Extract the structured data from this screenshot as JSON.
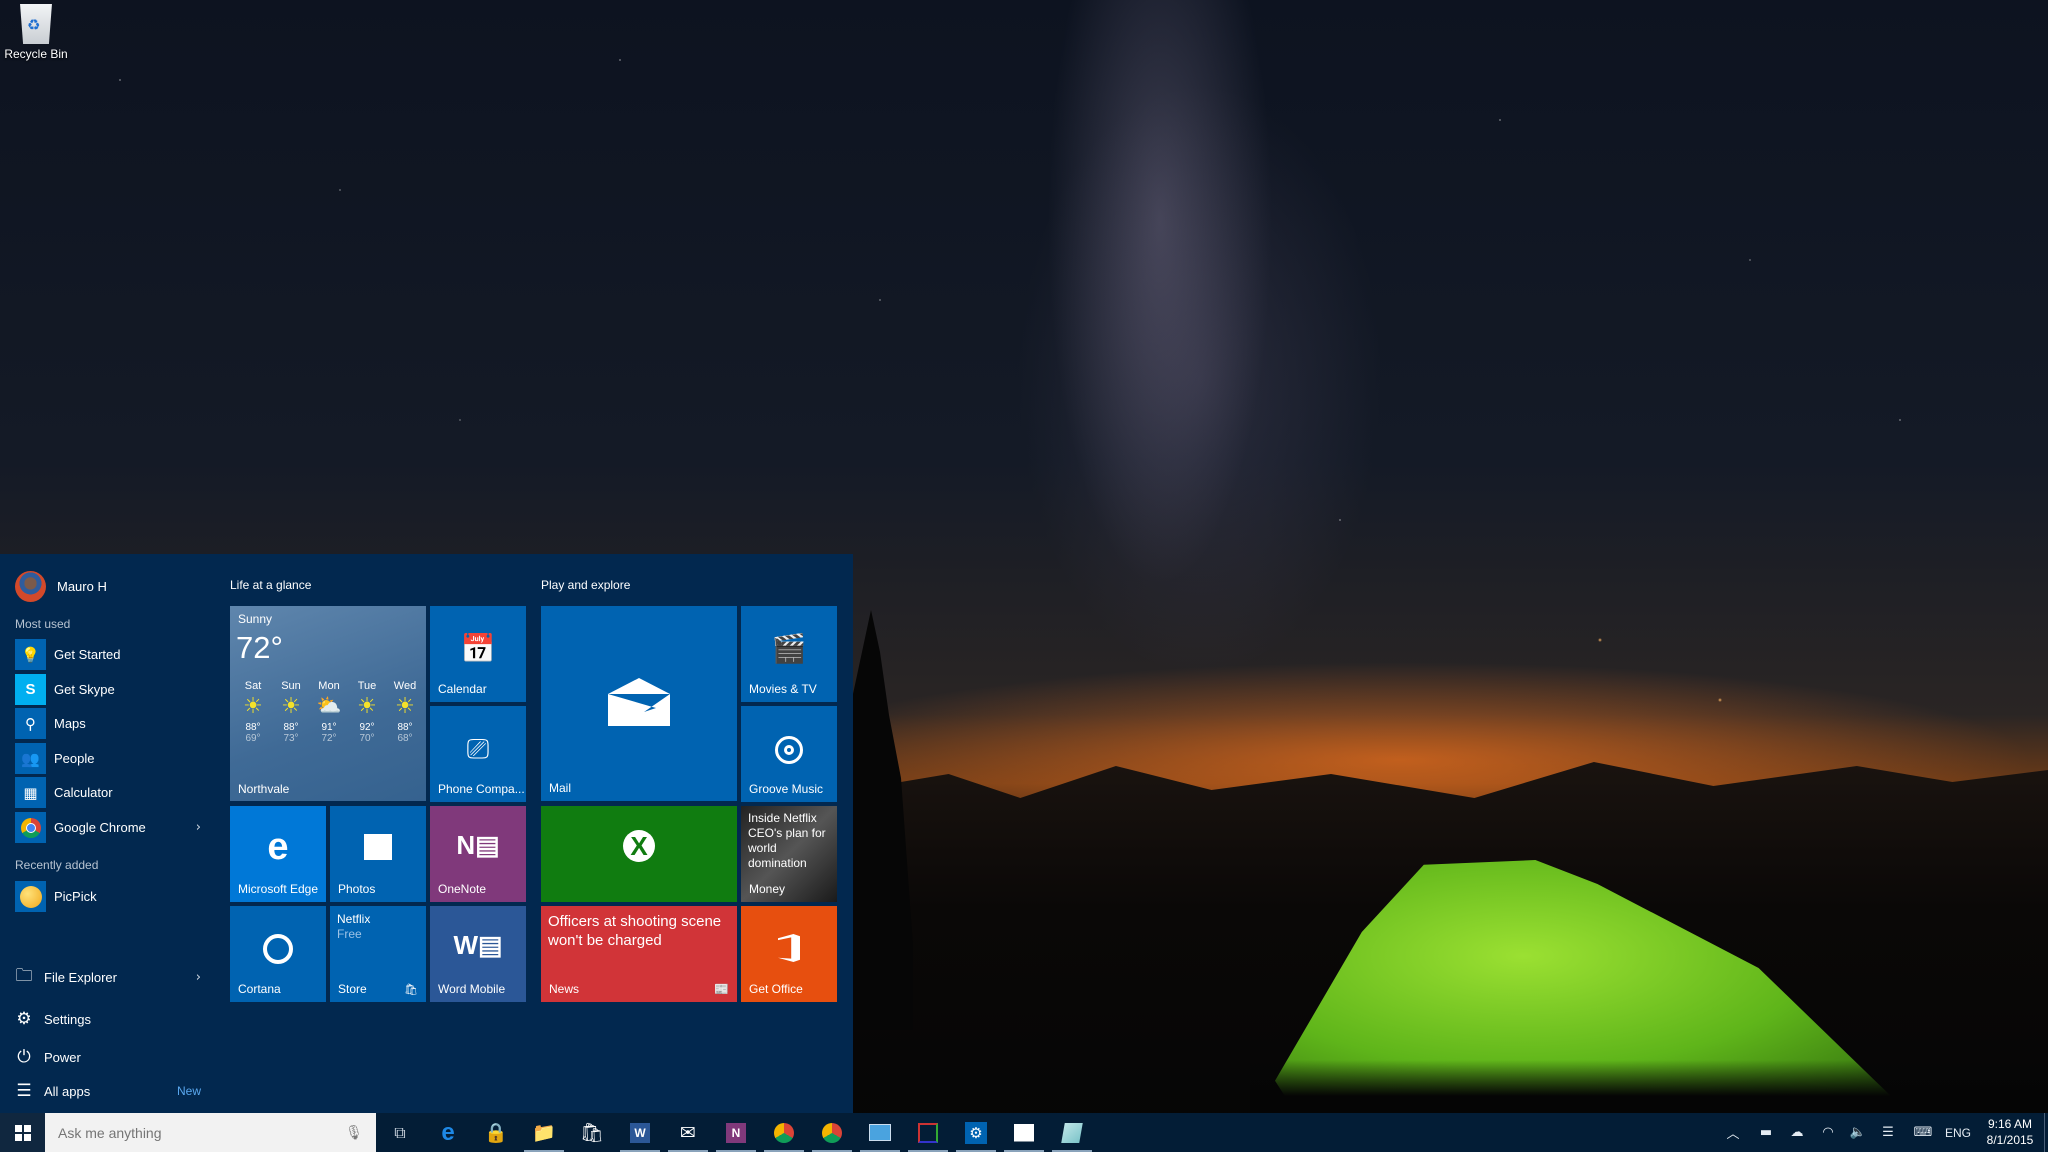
{
  "desktop": {
    "icons": [
      {
        "label": "Recycle Bin",
        "icon": "recycle-bin-icon"
      }
    ]
  },
  "start_menu": {
    "user": {
      "name": "Mauro H"
    },
    "most_used_label": "Most used",
    "most_used": [
      {
        "label": "Get Started",
        "icon": "lightbulb-icon",
        "color": "#0063b1"
      },
      {
        "label": "Get Skype",
        "icon": "skype-icon",
        "color": "#00aff0"
      },
      {
        "label": "Maps",
        "icon": "maps-icon",
        "color": "#0063b1"
      },
      {
        "label": "People",
        "icon": "people-icon",
        "color": "#0063b1"
      },
      {
        "label": "Calculator",
        "icon": "calculator-icon",
        "color": "#0063b1"
      },
      {
        "label": "Google Chrome",
        "icon": "chrome-icon",
        "color": "#0063b1",
        "has_submenu": true
      }
    ],
    "recently_added_label": "Recently added",
    "recently_added": [
      {
        "label": "PicPick",
        "icon": "picpick-icon"
      }
    ],
    "bottom": {
      "file_explorer": "File Explorer",
      "settings": "Settings",
      "power": "Power",
      "all_apps": "All apps",
      "all_apps_badge": "New"
    },
    "groups": {
      "life": {
        "label": "Life at a glance",
        "weather": {
          "condition": "Sunny",
          "temperature": "72°",
          "location": "Northvale",
          "forecast": [
            {
              "day": "Sat",
              "icon": "sun",
              "high": "88°",
              "low": "69°"
            },
            {
              "day": "Sun",
              "icon": "sun",
              "high": "88°",
              "low": "73°"
            },
            {
              "day": "Mon",
              "icon": "partly-cloudy",
              "high": "91°",
              "low": "72°"
            },
            {
              "day": "Tue",
              "icon": "sun",
              "high": "92°",
              "low": "70°"
            },
            {
              "day": "Wed",
              "icon": "sun",
              "high": "88°",
              "low": "68°"
            }
          ]
        },
        "tiles": {
          "calendar": "Calendar",
          "phone": "Phone Compa...",
          "edge": "Microsoft Edge",
          "photos": "Photos",
          "onenote": "OneNote",
          "cortana": "Cortana",
          "store": "Store",
          "store_title": "Netflix",
          "store_sub": "Free",
          "word": "Word Mobile"
        }
      },
      "play": {
        "label": "Play and explore",
        "tiles": {
          "mail": "Mail",
          "movies": "Movies & TV",
          "groove": "Groove Music",
          "xbox": "Xbox",
          "money": "Money",
          "money_headline": "Inside Netflix CEO's plan for world domination",
          "news": "News",
          "news_headline": "Officers at shooting scene won't be charged",
          "office": "Get Office"
        }
      }
    },
    "colors": {
      "menu_bg": "#02284f",
      "tile_blue": "#0063b1",
      "onenote": "#80397b",
      "xbox": "#107c10",
      "news": "#d13438",
      "office": "#e74f0f",
      "word": "#2b5797"
    }
  },
  "taskbar": {
    "search_placeholder": "Ask me anything",
    "apps": [
      {
        "name": "Task View",
        "icon": "task-view-icon",
        "open": false
      },
      {
        "name": "Microsoft Edge",
        "icon": "edge-icon",
        "open": false
      },
      {
        "name": "KeePass",
        "icon": "keepass-lock-icon",
        "open": false
      },
      {
        "name": "File Explorer",
        "icon": "folder-icon",
        "open": true
      },
      {
        "name": "Store",
        "icon": "store-icon",
        "open": false
      },
      {
        "name": "Word",
        "icon": "word-icon",
        "open": true
      },
      {
        "name": "Mail",
        "icon": "mail-icon",
        "open": true
      },
      {
        "name": "OneNote",
        "icon": "onenote-icon",
        "open": true
      },
      {
        "name": "Google Chrome",
        "icon": "chrome-icon",
        "open": true
      },
      {
        "name": "Google Chrome (profile)",
        "icon": "chrome-profile-icon",
        "open": true
      },
      {
        "name": "Remote Desktop",
        "icon": "remote-desktop-icon",
        "open": true
      },
      {
        "name": "PicPick",
        "icon": "picpick-icon",
        "open": true
      },
      {
        "name": "Settings",
        "icon": "gear-icon",
        "open": true
      },
      {
        "name": "Photos",
        "icon": "photos-icon",
        "open": true
      },
      {
        "name": "Notepad",
        "icon": "notepad-icon",
        "open": true
      }
    ],
    "tray": {
      "language": "ENG",
      "time": "9:16 AM",
      "date": "8/1/2015"
    }
  }
}
